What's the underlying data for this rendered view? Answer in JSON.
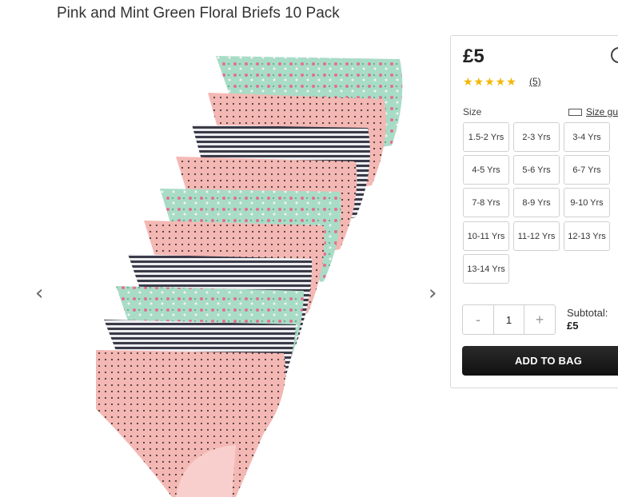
{
  "product": {
    "title": "Pink and Mint Green Floral Briefs 10 Pack",
    "price": "£5",
    "stars": "★★★★★",
    "review_count": "(5)"
  },
  "gallery": {
    "prev_arrow": "‹",
    "next_arrow": "›"
  },
  "size": {
    "label": "Size",
    "guide_label": "Size gu",
    "options": [
      "1.5-2 Yrs",
      "2-3 Yrs",
      "3-4 Yrs",
      "4-5 Yrs",
      "5-6 Yrs",
      "6-7 Yrs",
      "7-8 Yrs",
      "8-9 Yrs",
      "9-10 Yrs",
      "10-11 Yrs",
      "11-12 Yrs",
      "12-13 Yrs",
      "13-14 Yrs"
    ]
  },
  "quantity": {
    "minus": "-",
    "value": "1",
    "plus": "+"
  },
  "subtotal": {
    "label": "Subtotal:",
    "value": "£5"
  },
  "cta": {
    "add_to_bag": "ADD TO BAG"
  },
  "colors": {
    "pink": "#f4b8b4",
    "mint": "#a8dcc6",
    "stripe_dark": "#3a3a48",
    "star": "#f2b705"
  }
}
